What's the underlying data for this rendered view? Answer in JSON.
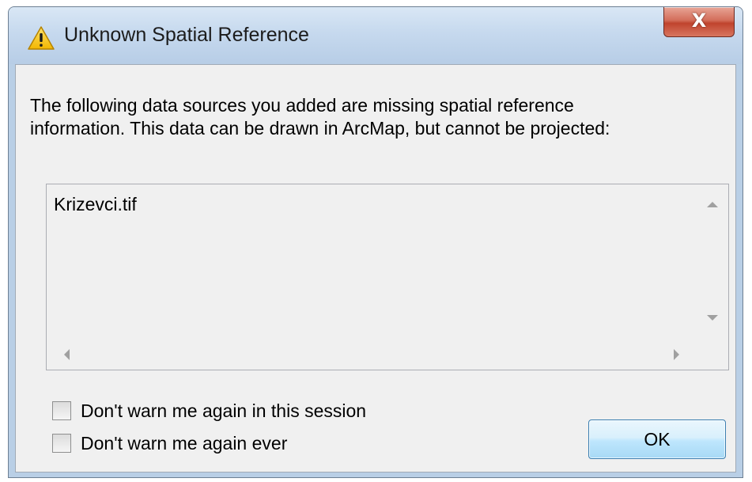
{
  "window": {
    "title": "Unknown Spatial Reference",
    "close_label": "X",
    "icon": "warning-icon"
  },
  "message": {
    "line1": "The following data sources you added are missing spatial reference",
    "line2": "information. This data can be drawn in ArcMap, but cannot be projected:"
  },
  "data_sources": {
    "items": [
      "Krizevci.tif"
    ]
  },
  "options": {
    "session_label": "Don't warn me again in this session",
    "ever_label": "Don't warn me again ever"
  },
  "buttons": {
    "ok_label": "OK"
  },
  "colors": {
    "titlebar": "#c6d9ee",
    "close_button": "#c0442e",
    "ok_button_border": "#3c7fb1",
    "warning_yellow": "#f7c600"
  }
}
